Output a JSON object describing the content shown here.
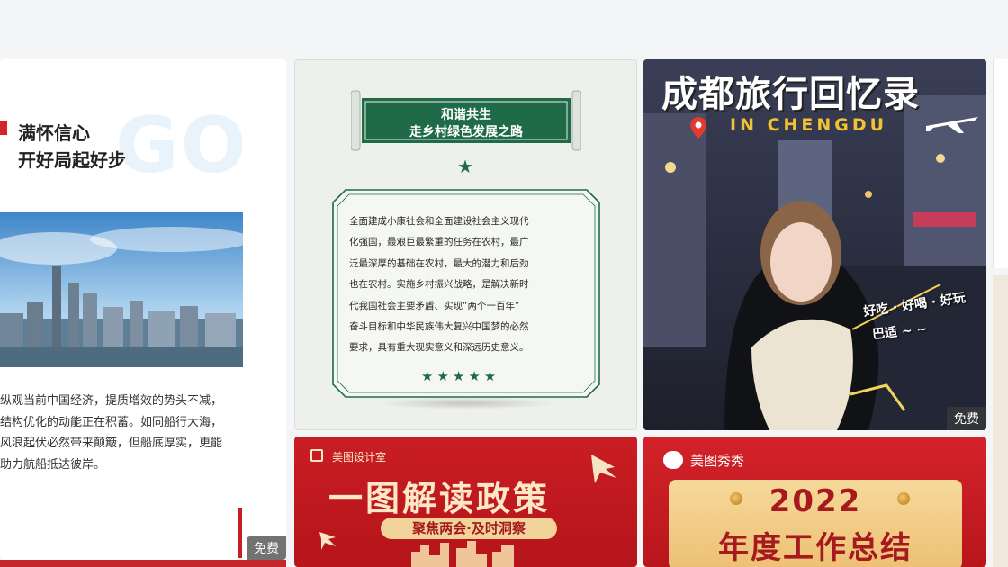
{
  "cards": {
    "card1": {
      "bg_word": "GO",
      "heading_line1": "满怀信心",
      "heading_line2": "开好局起好步",
      "paragraph": "纵观当前中国经济，提质增效的势头不减，\n结构优化的动能正在积蓄。如同船行大海，\n风浪起伏必然带来颠簸，但船底厚实，更能\n助力航船抵达彼岸。",
      "badge": "免费"
    },
    "card2": {
      "scroll_line1": "和谐共生",
      "scroll_line2": "走乡村绿色发展之路",
      "body": "全面建成小康社会和全面建设社会主义现代\n化强国，最艰巨最繁重的任务在农村，最广\n泛最深厚的基础在农村，最大的潜力和后劲\n也在农村。实施乡村振兴战略，是解决新时\n代我国社会主要矛盾、实现“两个一百年”\n奋斗目标和中华民族伟大复兴中国梦的必然\n要求，具有重大现实意义和深远历史意义。",
      "accent": "#1f6b47"
    },
    "card3": {
      "title": "成都旅行回忆录",
      "subtitle": "IN CHENGDU",
      "tag_line1": "好吃 · 好喝 · 好玩",
      "tag_line2": "巴适 ~ ~",
      "badge": "免费"
    },
    "card4": {
      "brand": "美图设计室",
      "headline": "一图解读政策",
      "pill": "聚焦两会·及时洞察"
    },
    "card5": {
      "brand": "美图秀秀",
      "year": "2022",
      "title": "年度工作总结"
    }
  },
  "colors": {
    "page_bg": "#f4f5f7",
    "red": "#c91d23",
    "gold": "#f2d49a",
    "green": "#1f6b47"
  },
  "icons": [
    "pin-icon",
    "plane-icon",
    "star-icon",
    "dove-icon",
    "brand-logo-icon"
  ]
}
